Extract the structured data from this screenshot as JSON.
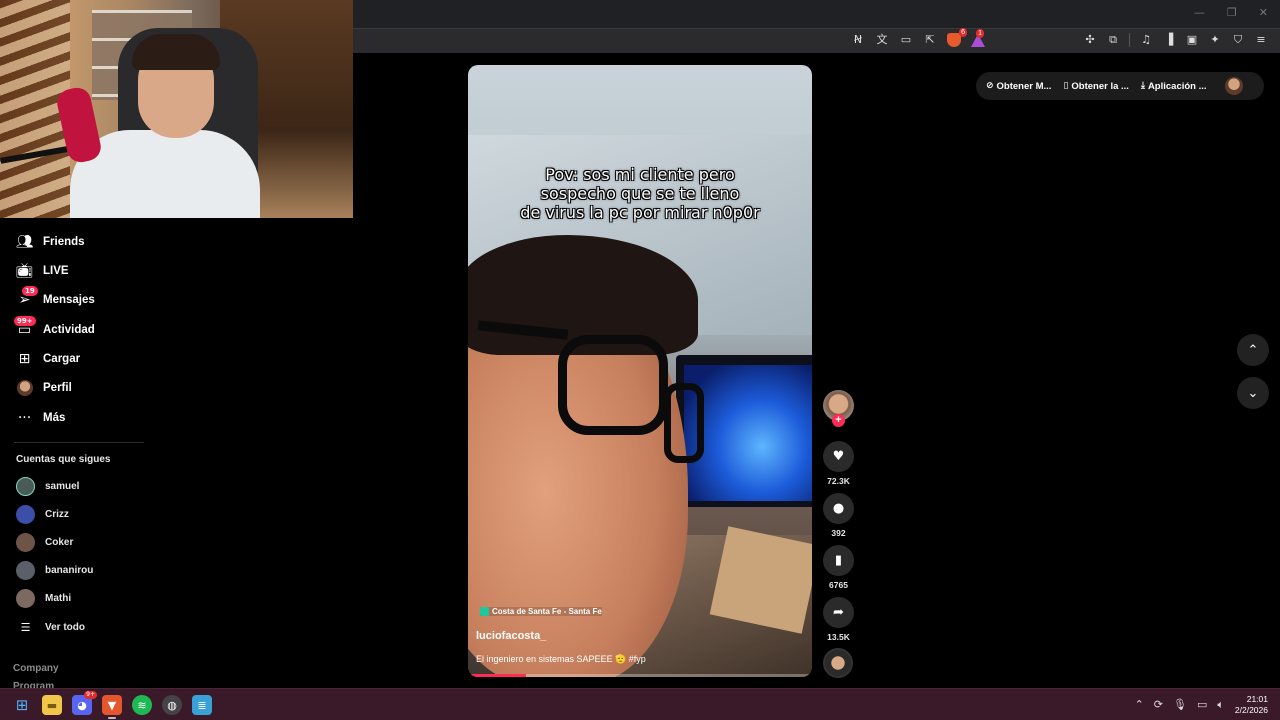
{
  "browser": {
    "window_controls": [
      "—",
      "❐",
      "✕"
    ],
    "toolbar_badges": {
      "brave_shield": "6",
      "brave_rewards": "1"
    }
  },
  "sidebar": {
    "items": [
      {
        "label": "Friends",
        "icon": "friends-icon"
      },
      {
        "label": "LIVE",
        "icon": "live-icon"
      },
      {
        "label": "Mensajes",
        "icon": "messages-icon",
        "badge": "19"
      },
      {
        "label": "Actividad",
        "icon": "activity-icon",
        "badge": "99+"
      },
      {
        "label": "Cargar",
        "icon": "upload-icon"
      },
      {
        "label": "Perfil",
        "icon": "profile-avatar"
      },
      {
        "label": "Más",
        "icon": "more-icon"
      }
    ],
    "following_title": "Cuentas que sigues",
    "following": [
      {
        "name": "samuel",
        "color": "#4a5a55"
      },
      {
        "name": "Crizz",
        "color": "#3b4ea8"
      },
      {
        "name": "Coker",
        "color": "#6d5446"
      },
      {
        "name": "bananirou",
        "color": "#5a5f6a"
      },
      {
        "name": "Mathi",
        "color": "#7c6a60"
      }
    ],
    "see_all": "Ver todo",
    "footer": [
      "Company",
      "Program"
    ]
  },
  "topbar": {
    "items": [
      {
        "label": "Obtener M...",
        "icon": "coin-icon"
      },
      {
        "label": "Obtener la ...",
        "icon": "phone-icon"
      },
      {
        "label": "Aplicación ...",
        "icon": "download-icon"
      }
    ]
  },
  "video": {
    "caption_lines": [
      "Pov: sos mi cliente pero",
      "sospecho que se te lleno",
      "de virus la pc por mirar n0p0r"
    ],
    "location": "Costa de Santa Fe - Santa Fe",
    "username": "luciofacosta_",
    "description": "El ingeniero en sistemas SAPEEE 🫡 #fyp",
    "progress": 0.17
  },
  "actions": {
    "likes": "72.3K",
    "comments": "392",
    "saves": "6765",
    "shares": "13.5K"
  },
  "taskbar": {
    "discord_badge": "9+",
    "time": "21:01",
    "date": "2/2/2026"
  },
  "colors": {
    "accent": "#fe2c55",
    "taskbar": "#3a1a28"
  }
}
